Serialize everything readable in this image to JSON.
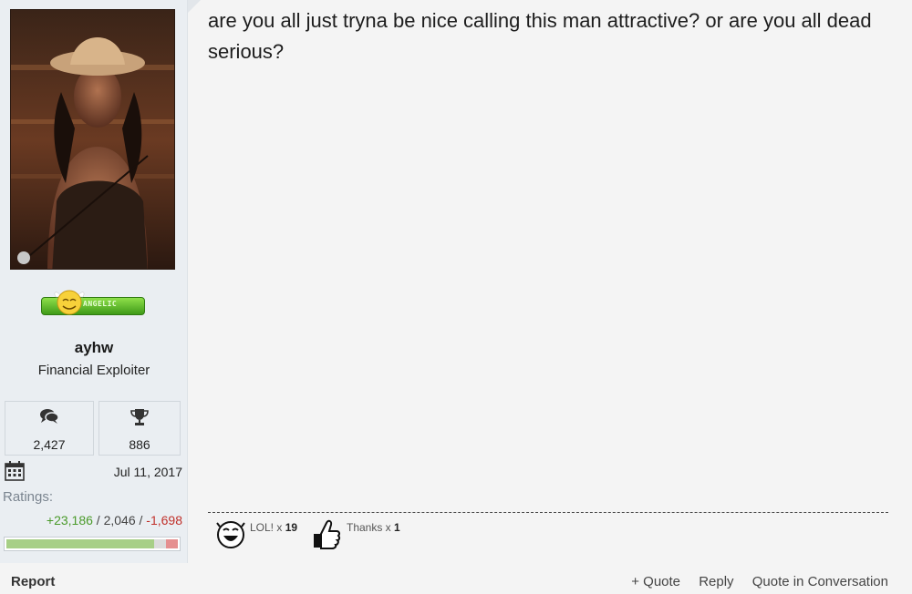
{
  "post": {
    "message": "are you all just tryna be nice calling this man attractive? or are you all dead serious?"
  },
  "user": {
    "name": "ayhw",
    "title": "Financial Exploiter",
    "badge_text": "ANGELIC",
    "stats": {
      "messages": "2,427",
      "trophies": "886"
    },
    "joined": "Jul 11, 2017",
    "ratings_label": "Ratings:",
    "ratings": {
      "positive": "+23,186",
      "neutral": "2,046",
      "negative": "-1,698",
      "separator": " / "
    },
    "rating_bar_fractions": {
      "positive": 0.86,
      "neutral": 0.07,
      "negative": 0.07
    }
  },
  "reactions": [
    {
      "label": "LOL! x ",
      "count": "19",
      "icon": "laugh-icon"
    },
    {
      "label": "Thanks x ",
      "count": "1",
      "icon": "thumbs-up-icon"
    }
  ],
  "footer": {
    "report": "Report",
    "quote": "+ Quote",
    "reply": "Reply",
    "quote_conversation": "Quote in Conversation"
  },
  "colors": {
    "positive": "#4a9a2a",
    "negative": "#c0302a",
    "badge_green": "#3f9a18"
  }
}
